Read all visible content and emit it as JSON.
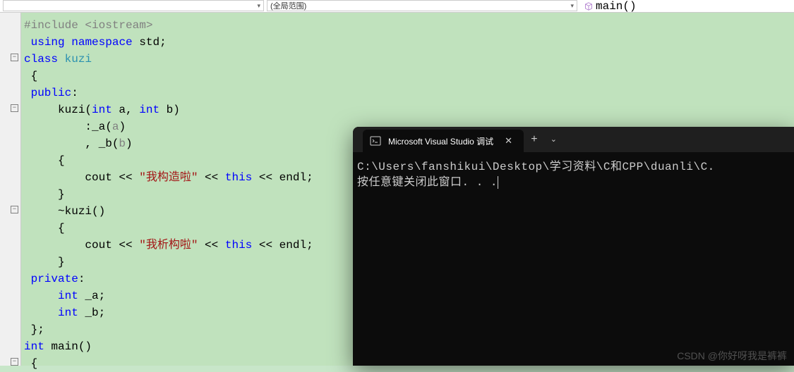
{
  "topbar": {
    "scope": "(全局范围)",
    "function": "main()"
  },
  "code": {
    "l1_pre": "#include ",
    "l1_inc": "<iostream>",
    "l2_kw1": "using",
    "l2_kw2": "namespace",
    "l2_id": " std;",
    "l3_kw": "class",
    "l3_cls": " kuzi",
    "l4": " {",
    "l5_kw": " public",
    "l5_colon": ":",
    "l6a": "     kuzi(",
    "l6_int": "int",
    "l6b": " a, ",
    "l6c": " b)",
    "l7": "         :_a(",
    "l7_a": "a",
    "l7_end": ")",
    "l8": "         , _b(",
    "l8_b": "b",
    "l8_end": ")",
    "l9": "     {",
    "l10a": "         cout << ",
    "l10_str": "\"我构造啦\"",
    "l10b": " << ",
    "l10_this": "this",
    "l10c": " << endl;",
    "l11": "     }",
    "l12": "     ~kuzi()",
    "l13": "     {",
    "l14a": "         cout << ",
    "l14_str": "\"我析构啦\"",
    "l14b": " << ",
    "l14_this": "this",
    "l14c": " << endl;",
    "l15": "     }",
    "l16_kw": " private",
    "l16_colon": ":",
    "l17a": "     ",
    "l17_int": "int",
    "l17b": " _a;",
    "l18a": "     ",
    "l18_int": "int",
    "l18b": " _b;",
    "l19": " };",
    "l20_int": "int",
    "l20b": " main()",
    "l21": " {"
  },
  "terminal": {
    "tab_title": "Microsoft Visual Studio 调试",
    "line1": "C:\\Users\\fanshikui\\Desktop\\学习资料\\C和CPP\\duanli\\C.",
    "line2": "按任意键关闭此窗口. . ."
  },
  "watermark": "CSDN @你好呀我是裤裤"
}
